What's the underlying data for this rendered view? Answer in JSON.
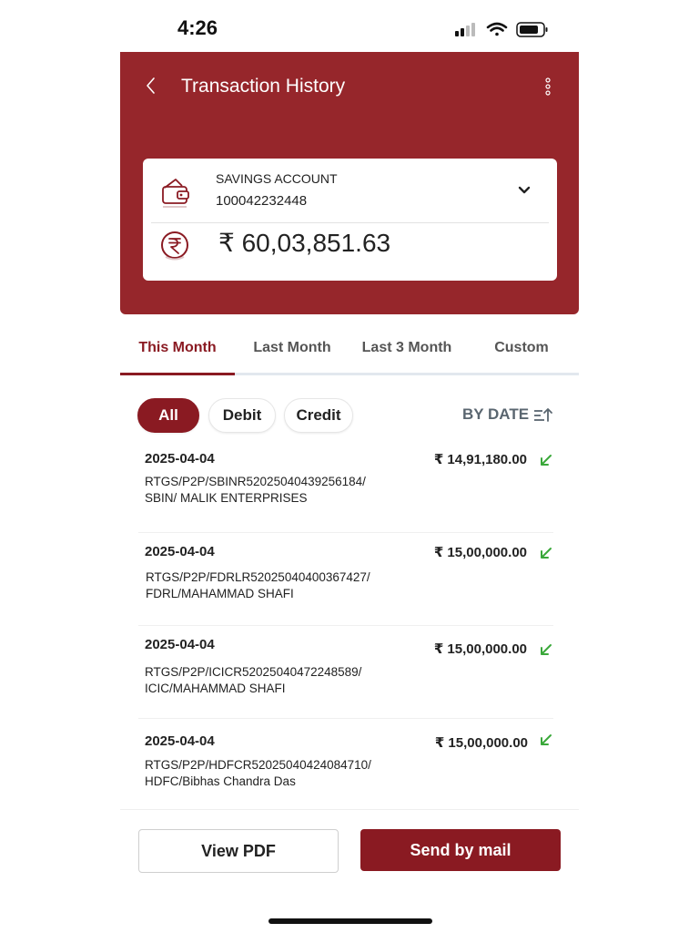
{
  "status_bar": {
    "time": "4:26"
  },
  "header": {
    "title": "Transaction History"
  },
  "account": {
    "type": "SAVINGS ACCOUNT",
    "number": "100042232448",
    "balance": "₹ 60,03,851.63"
  },
  "tabs": [
    {
      "label": "This Month",
      "active": true
    },
    {
      "label": "Last Month",
      "active": false
    },
    {
      "label": "Last 3 Month",
      "active": false
    },
    {
      "label": "Custom",
      "active": false
    }
  ],
  "filters": {
    "chips": [
      {
        "label": "All",
        "active": true
      },
      {
        "label": "Debit",
        "active": false
      },
      {
        "label": "Credit",
        "active": false
      }
    ],
    "sort_label": "BY DATE"
  },
  "transactions": [
    {
      "date": "2025-04-04",
      "amount": "₹ 14,91,180.00",
      "desc_line1": "RTGS/P2P/SBINR52025040439256184/",
      "desc_line2": "SBIN/ MALIK ENTERPRISES"
    },
    {
      "date": "2025-04-04",
      "amount": "₹ 15,00,000.00",
      "desc_line1": "RTGS/P2P/FDRLR52025040400367427/",
      "desc_line2": "FDRL/MAHAMMAD SHAFI"
    },
    {
      "date": "2025-04-04",
      "amount": "₹ 15,00,000.00",
      "desc_line1": "RTGS/P2P/ICICR52025040472248589/",
      "desc_line2": "ICIC/MAHAMMAD SHAFI"
    },
    {
      "date": "2025-04-04",
      "amount": "₹ 15,00,000.00",
      "desc_line1": "RTGS/P2P/HDFCR52025040424084710/",
      "desc_line2": "HDFC/Bibhas Chandra Das"
    }
  ],
  "actions": {
    "view_pdf": "View PDF",
    "send_mail": "Send by mail"
  },
  "icons": {
    "back": "chevron-left-icon",
    "menu": "more-vertical-icon",
    "wallet": "wallet-icon",
    "rupee": "rupee-circle-icon",
    "dropdown": "chevron-down-icon",
    "sort": "sort-ascending-icon",
    "credit_arrow": "arrow-down-left-icon"
  },
  "colors": {
    "brand": "#96262b",
    "accent": "#8a1a22",
    "credit_arrow": "#3aa83a"
  }
}
